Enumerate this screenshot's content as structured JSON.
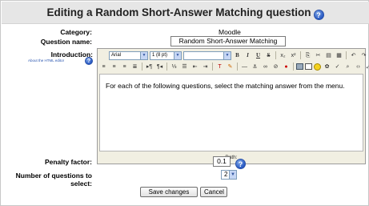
{
  "header": {
    "title": "Editing a Random Short-Answer Matching question"
  },
  "form": {
    "category": {
      "label": "Category:",
      "value": "Moodle"
    },
    "question_name": {
      "label": "Question name:",
      "value": "Random Short-Answer Matching"
    },
    "introduction": {
      "label": "Introduction:",
      "help_link": "About the HTML editor",
      "font_family": "Arial",
      "font_size": "1 (8 pt)",
      "paragraph_format": "",
      "content": "For each of the following questions, select the matching answer from the menu.",
      "path_label": "Path:"
    },
    "penalty_factor": {
      "label": "Penalty factor:",
      "value": "0.1"
    },
    "num_questions": {
      "label": "Number of questions to select:",
      "value": "2"
    }
  },
  "buttons": {
    "save_label": "Save changes",
    "cancel_label": "Cancel"
  }
}
